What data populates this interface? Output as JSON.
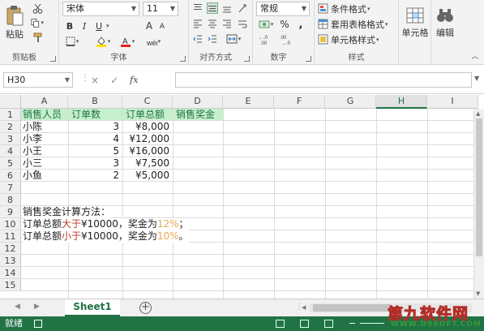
{
  "ribbon": {
    "clipboard": {
      "paste": "粘贴",
      "label": "剪贴板"
    },
    "font": {
      "name": "宋体",
      "size": "11",
      "label": "字体",
      "bold": "B",
      "italic": "I",
      "underline": "U",
      "grow": "A",
      "shrink": "A"
    },
    "alignment": {
      "label": "对齐方式"
    },
    "number": {
      "format": "常规",
      "label": "数字",
      "percent": "%",
      "comma": ","
    },
    "styles": {
      "conditional": "条件格式",
      "table": "套用表格格式",
      "cell": "单元格样式",
      "label": "样式"
    },
    "cells": {
      "label": "单元格"
    },
    "editing": {
      "label": "编辑"
    }
  },
  "formula_bar": {
    "name_box": "H30",
    "fx": "fx",
    "cancel": "×",
    "enter": "✓",
    "value": ""
  },
  "columns": [
    "A",
    "B",
    "C",
    "D",
    "E",
    "F",
    "G",
    "H",
    "I"
  ],
  "selected_column": "H",
  "rows": [
    "1",
    "2",
    "3",
    "4",
    "5",
    "6",
    "7",
    "8",
    "9",
    "10",
    "11",
    "12",
    "13",
    "14",
    "15"
  ],
  "sheet": {
    "headers": [
      "销售人员",
      "订单数",
      "订单总额",
      "销售奖金"
    ],
    "data": [
      {
        "name": "小陈",
        "orders": "3",
        "total": "¥8,000"
      },
      {
        "name": "小李",
        "orders": "4",
        "total": "¥12,000"
      },
      {
        "name": "小王",
        "orders": "5",
        "total": "¥16,000"
      },
      {
        "name": "小三",
        "orders": "3",
        "total": "¥7,500"
      },
      {
        "name": "小鱼",
        "orders": "2",
        "total": "¥5,000"
      }
    ],
    "note_title": "销售奖金计算方法：",
    "rule1": {
      "p1": "订单总额",
      "cmp": "大于",
      "p2": "¥10000，奖金为",
      "pct": "12%",
      "end": "；"
    },
    "rule2": {
      "p1": "订单总额",
      "cmp": "小于",
      "p2": "¥10000，奖金为",
      "pct": "10%",
      "end": "。"
    }
  },
  "tabs": {
    "sheet1": "Sheet1",
    "add": "+"
  },
  "status": {
    "text": "就绪"
  },
  "watermark": {
    "big": "第九软件网",
    "small": "WWW.D9SOFT.COM"
  },
  "colors": {
    "accent": "#217346",
    "header_fill": "#c6efce",
    "header_text": "#217346"
  }
}
